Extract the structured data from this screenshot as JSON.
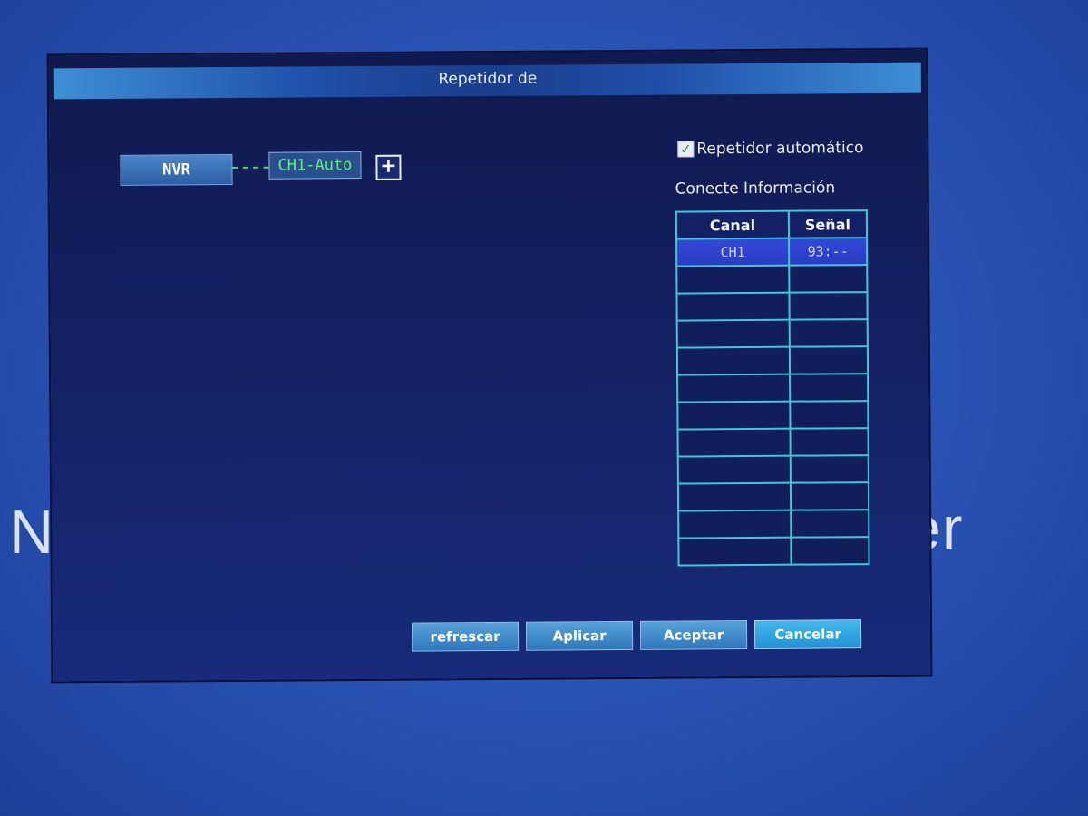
{
  "background": {
    "text_left": "Ne",
    "text_right": "er"
  },
  "dialog": {
    "title": "Repetidor de"
  },
  "topology": {
    "nvr_label": "NVR",
    "channel_label": "CH1-Auto",
    "add_symbol": "+"
  },
  "auto_repeater": {
    "checked": true,
    "label": "Repetidor automático"
  },
  "connection_info": {
    "heading": "Conecte Información",
    "columns": [
      "Canal",
      "Señal"
    ],
    "rows": [
      {
        "canal": "CH1",
        "senal": "93:--"
      },
      {
        "canal": "",
        "senal": ""
      },
      {
        "canal": "",
        "senal": ""
      },
      {
        "canal": "",
        "senal": ""
      },
      {
        "canal": "",
        "senal": ""
      },
      {
        "canal": "",
        "senal": ""
      },
      {
        "canal": "",
        "senal": ""
      },
      {
        "canal": "",
        "senal": ""
      },
      {
        "canal": "",
        "senal": ""
      },
      {
        "canal": "",
        "senal": ""
      },
      {
        "canal": "",
        "senal": ""
      },
      {
        "canal": "",
        "senal": ""
      }
    ]
  },
  "buttons": {
    "refresh": "refrescar",
    "apply": "Aplicar",
    "accept": "Aceptar",
    "cancel": "Cancelar"
  },
  "colors": {
    "table_border": "#3ccad8",
    "channel_text": "#5cf07a",
    "selected_row": "#3348d8"
  }
}
